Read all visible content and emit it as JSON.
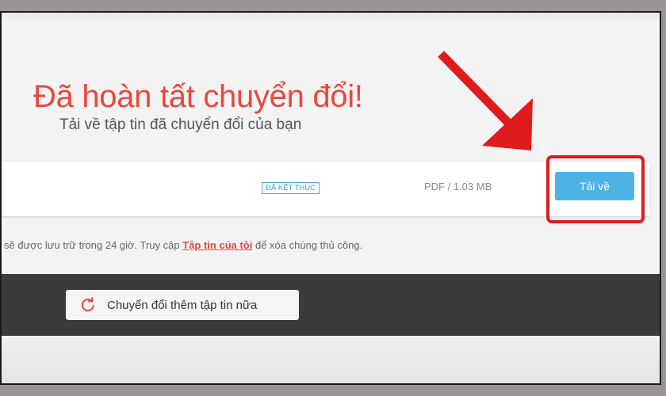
{
  "hero": {
    "title": "Đã hoàn tất chuyển đổi!",
    "subtitle": "Tải về tập tin đã chuyển đổi của bạn"
  },
  "file_row": {
    "status_badge": "ĐÃ KẾT THÚC",
    "file_info": "PDF / 1.03 MB",
    "download_label": "Tải về"
  },
  "retention_note": {
    "before": "sẽ được lưu trữ trong 24 giờ. Truy cập ",
    "link": "Tập tin của tôi",
    "after": " để xóa chúng thủ công."
  },
  "actions": {
    "convert_more_label": "Chuyển đổi thêm tập tin nữa",
    "convert_more_icon": "refresh-icon"
  },
  "colors": {
    "accent_red": "#e9473c",
    "button_blue": "#4db3e6",
    "highlight_red": "#e01b1b"
  }
}
